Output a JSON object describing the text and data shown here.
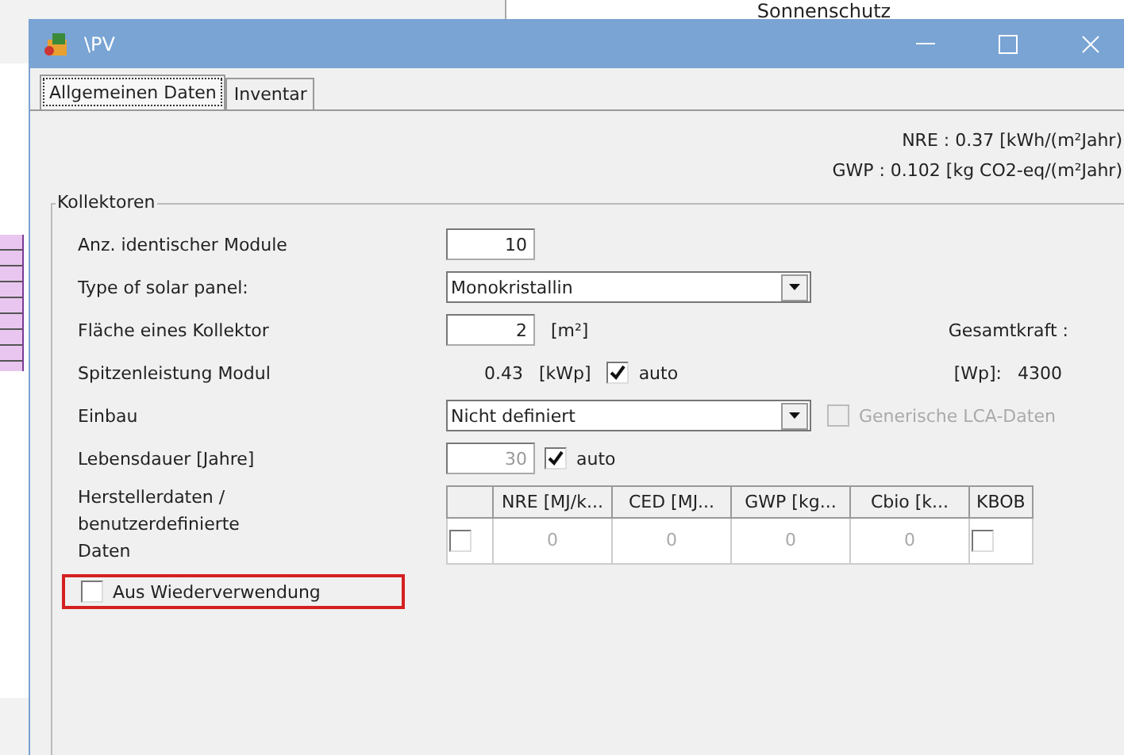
{
  "background_window": {
    "title": "Sonnenschutz"
  },
  "window": {
    "title": "\\PV"
  },
  "tabs": [
    {
      "label": "Allgemeinen Daten",
      "selected": true
    },
    {
      "label": "Inventar",
      "selected": false
    }
  ],
  "indicators": [
    {
      "text": "NRE : 0.37 [kWh/(m²Jahr)"
    },
    {
      "text": "GWP : 0.102 [kg CO2-eq/(m²Jahr)"
    }
  ],
  "group": {
    "title": "Kollektoren"
  },
  "module_count": {
    "label": "Anz. identischer Module",
    "value": "10"
  },
  "panel_type": {
    "label": "Type of solar panel:",
    "value": "Monokristallin"
  },
  "area": {
    "label": "Fläche eines Kollektor",
    "value": "2",
    "unit": "[m²]"
  },
  "total_power": {
    "label": "Gesamtkraft :",
    "unit": "[Wp]:",
    "value": "4300"
  },
  "peak_power": {
    "label": "Spitzenleistung Modul",
    "value": "0.43",
    "unit": "[kWp]",
    "auto": {
      "label": "auto",
      "checked": true
    }
  },
  "installation": {
    "label": "Einbau",
    "value": "Nicht definiert",
    "generic_lca": {
      "label": "Generische LCA-Daten",
      "checked": false,
      "disabled": true
    }
  },
  "lifetime": {
    "label": "Lebensdauer [Jahre]",
    "value": "30",
    "disabled": true,
    "auto": {
      "label": "auto",
      "checked": true
    }
  },
  "manufacturer_data": {
    "label": "Herstellerdaten / benutzerdefinierte Daten",
    "table": {
      "columns": [
        "NRE [MJ/k...",
        "CED [MJ...",
        "GWP [kg...",
        "Cbio [k...",
        "KBOB"
      ],
      "rows": [
        {
          "checked": false,
          "cells": [
            "0",
            "0",
            "0",
            "0"
          ],
          "kbob": false
        }
      ]
    }
  },
  "reuse": {
    "label": "Aus Wiederverwendung",
    "checked": false
  }
}
